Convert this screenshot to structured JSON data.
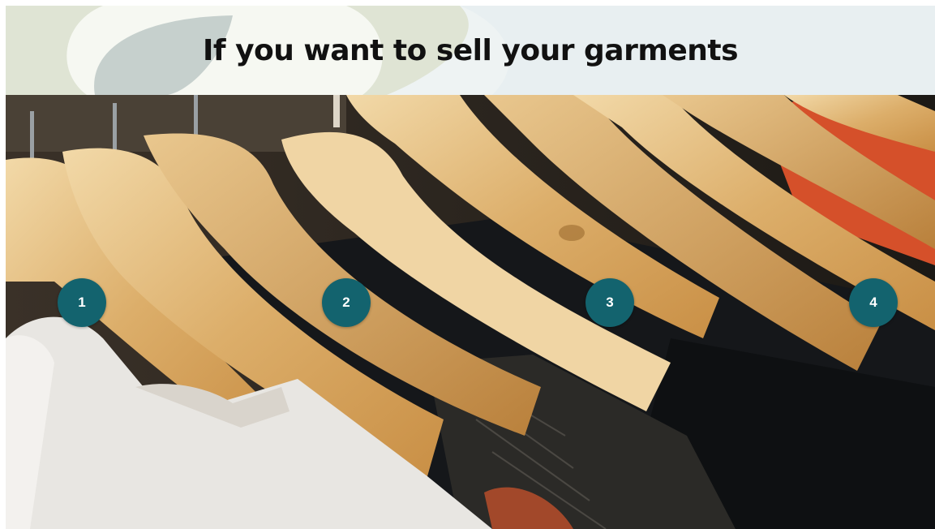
{
  "slide": {
    "title": "If you want to sell your garments",
    "steps": [
      {
        "label": "1"
      },
      {
        "label": "2"
      },
      {
        "label": "3"
      },
      {
        "label": "4"
      }
    ]
  },
  "colors": {
    "step_circle": "#13636e",
    "header_background": "#eef3f3",
    "header_shape_sage": "#dfe4d4",
    "header_shape_gray": "#c6d0cd"
  },
  "icons": {
    "background_photo": "clothes-on-wooden-hangers-image"
  }
}
